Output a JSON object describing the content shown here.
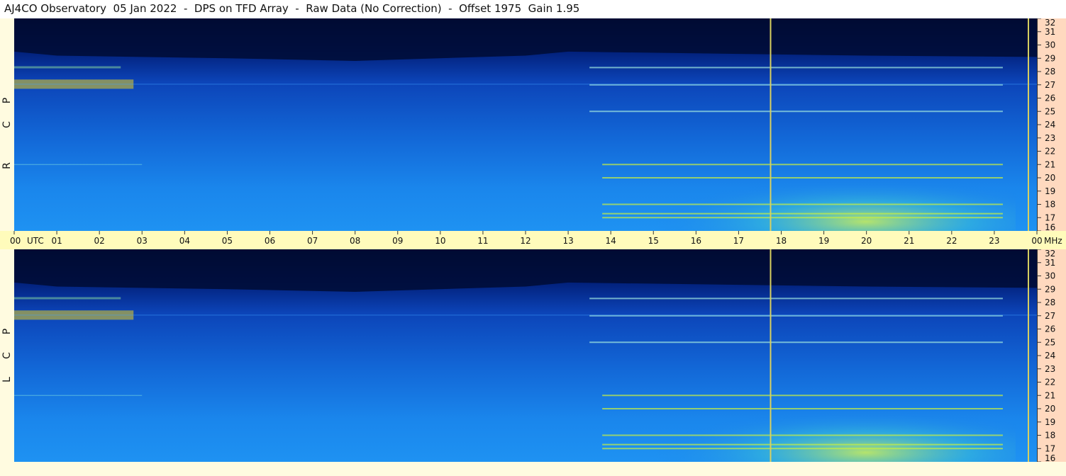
{
  "header": {
    "title": "AJ4CO Observatory  05 Jan 2022  -  DPS on TFD Array  -  Raw Data (No Correction)  -  Offset 1975  Gain 1.95"
  },
  "panels": {
    "top_label": [
      "R",
      "C",
      "P"
    ],
    "bottom_label": [
      "L",
      "C",
      "P"
    ]
  },
  "colors": {
    "background": "#fffbe0",
    "time_bar": "#fffbbb",
    "freq_axis": "#ffd9bf",
    "marker_line": "#d8d060",
    "spectrogram_low": "#00104a",
    "spectrogram_mid": "#1e7ae6",
    "spectrogram_high": "#e8ff40"
  },
  "chart_data": {
    "type": "heatmap",
    "x": {
      "unit": "UTC",
      "ticks": [
        "00",
        "01",
        "02",
        "03",
        "04",
        "05",
        "06",
        "07",
        "08",
        "09",
        "10",
        "11",
        "12",
        "13",
        "14",
        "15",
        "16",
        "17",
        "18",
        "19",
        "20",
        "21",
        "22",
        "23",
        "00"
      ],
      "tick_hours": [
        0,
        1,
        2,
        3,
        4,
        5,
        6,
        7,
        8,
        9,
        10,
        11,
        12,
        13,
        14,
        15,
        16,
        17,
        18,
        19,
        20,
        21,
        22,
        23,
        24
      ],
      "range": [
        0,
        24
      ]
    },
    "y": {
      "unit": "MHz",
      "ticks": [
        "16",
        "17",
        "18",
        "19",
        "20",
        "21",
        "22",
        "23",
        "24",
        "25",
        "26",
        "27",
        "28",
        "29",
        "30",
        "31",
        "32"
      ],
      "tick_values": [
        16,
        17,
        18,
        19,
        20,
        21,
        22,
        23,
        24,
        25,
        26,
        27,
        28,
        29,
        30,
        31,
        32
      ],
      "range": [
        16,
        32
      ]
    },
    "panels": [
      "RCP",
      "LCP"
    ],
    "marker_lines_utc": [
      17.75,
      23.8
    ],
    "interference_bands_mhz": [
      17.0,
      17.3,
      18.0,
      20.0,
      21.0,
      25.0,
      27.0,
      28.3
    ]
  }
}
